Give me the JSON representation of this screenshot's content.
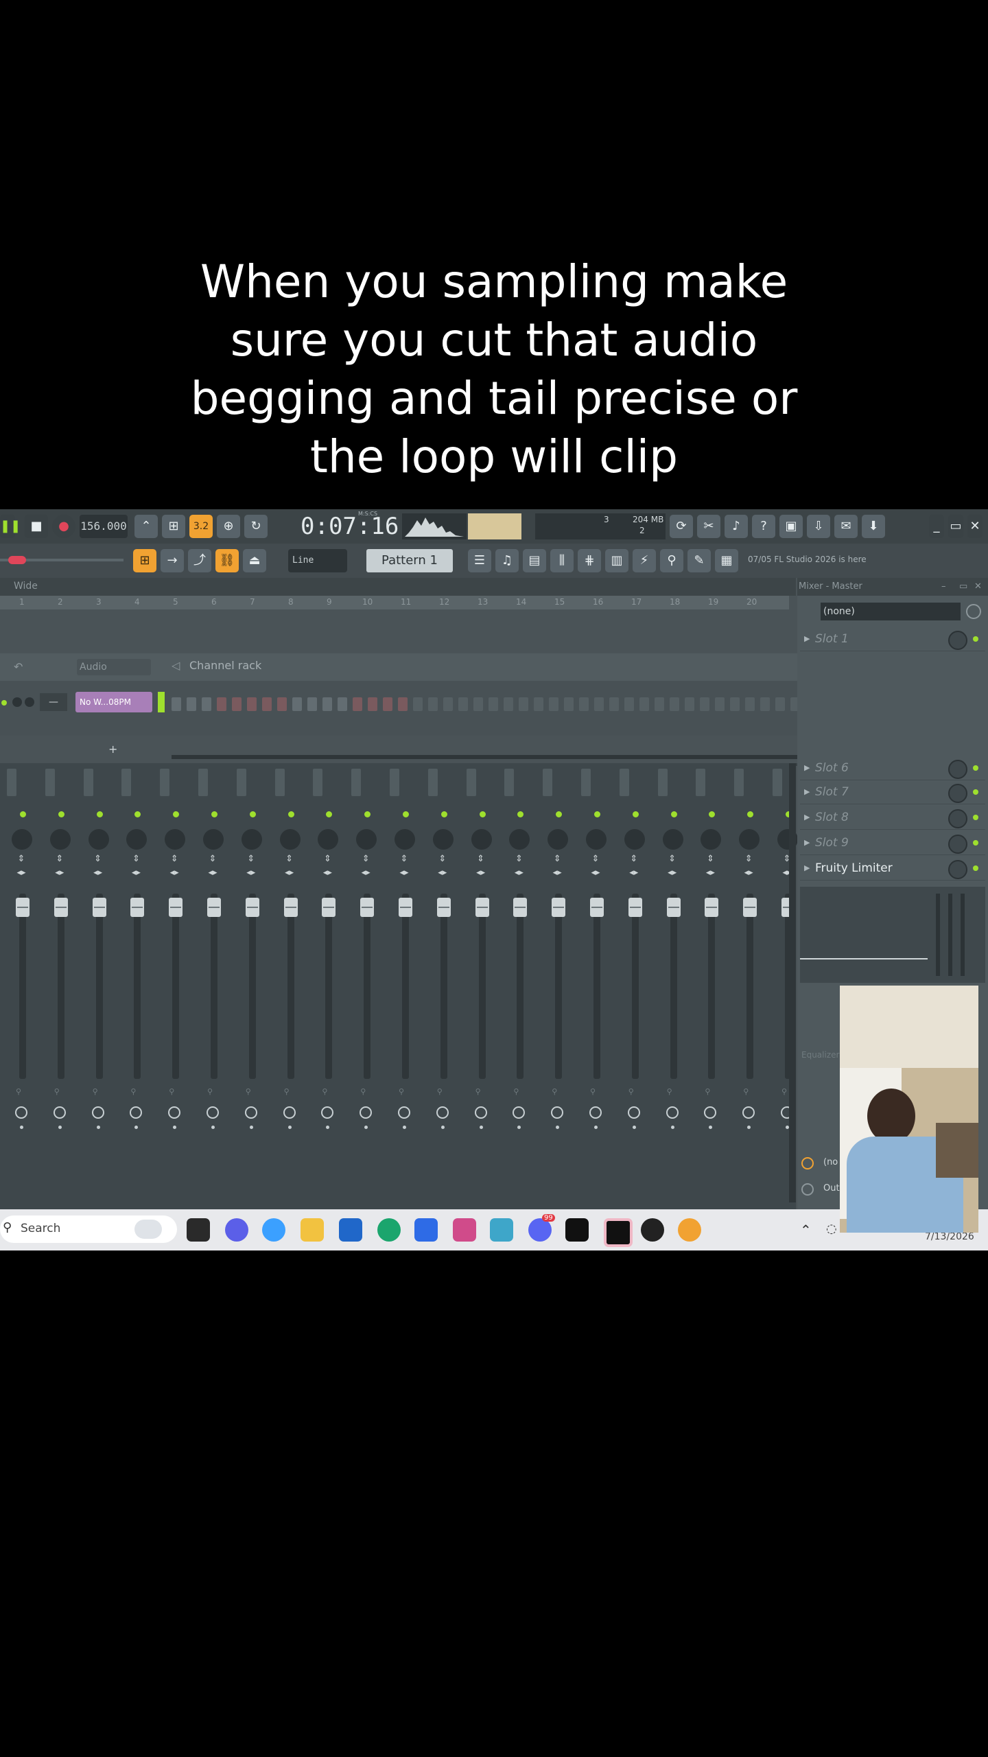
{
  "caption": "When you sampling make sure you cut that audio begging and tail precise or the loop will clip",
  "toolbar": {
    "tempo": "156.000",
    "time_display": "0:07:16",
    "time_label": "M:S:CS",
    "pattern": "Pattern 1",
    "snap": "Line",
    "memory": "204 MB",
    "cpu_value": "3",
    "poly_value": "2",
    "news": "07/05  FL Studio 2026 is here",
    "step_indicator": "3.2"
  },
  "playlist": {
    "title": "Wide",
    "ruler": [
      "1",
      "2",
      "3",
      "4",
      "5",
      "6",
      "7",
      "8",
      "9",
      "10",
      "11",
      "12",
      "13",
      "14",
      "15",
      "16",
      "17",
      "18",
      "19",
      "20"
    ]
  },
  "channel_rack": {
    "filter": "Audio",
    "title": "Channel rack",
    "channel_name": "No W...08PM"
  },
  "mixer": {
    "title": "Mixer - Master",
    "input": "(none)",
    "strip_label": "Insert",
    "strips": 21,
    "slots_top": [
      {
        "name": "Slot 1"
      }
    ],
    "slots_bottom": [
      {
        "name": "Slot 6"
      },
      {
        "name": "Slot 7"
      },
      {
        "name": "Slot 8"
      },
      {
        "name": "Slot 9"
      },
      {
        "name": "Fruity Limiter"
      }
    ],
    "equalizer_label": "Equalizer",
    "out_label_1": "(no",
    "out_label_2": "Out"
  },
  "taskbar": {
    "search_placeholder": "Search",
    "date": "7/13/2026",
    "discord_badge": "99"
  },
  "colors": {
    "accent_orange": "#f1a232",
    "led_green": "#9fe02e",
    "bg_dark": "#3e474b"
  }
}
